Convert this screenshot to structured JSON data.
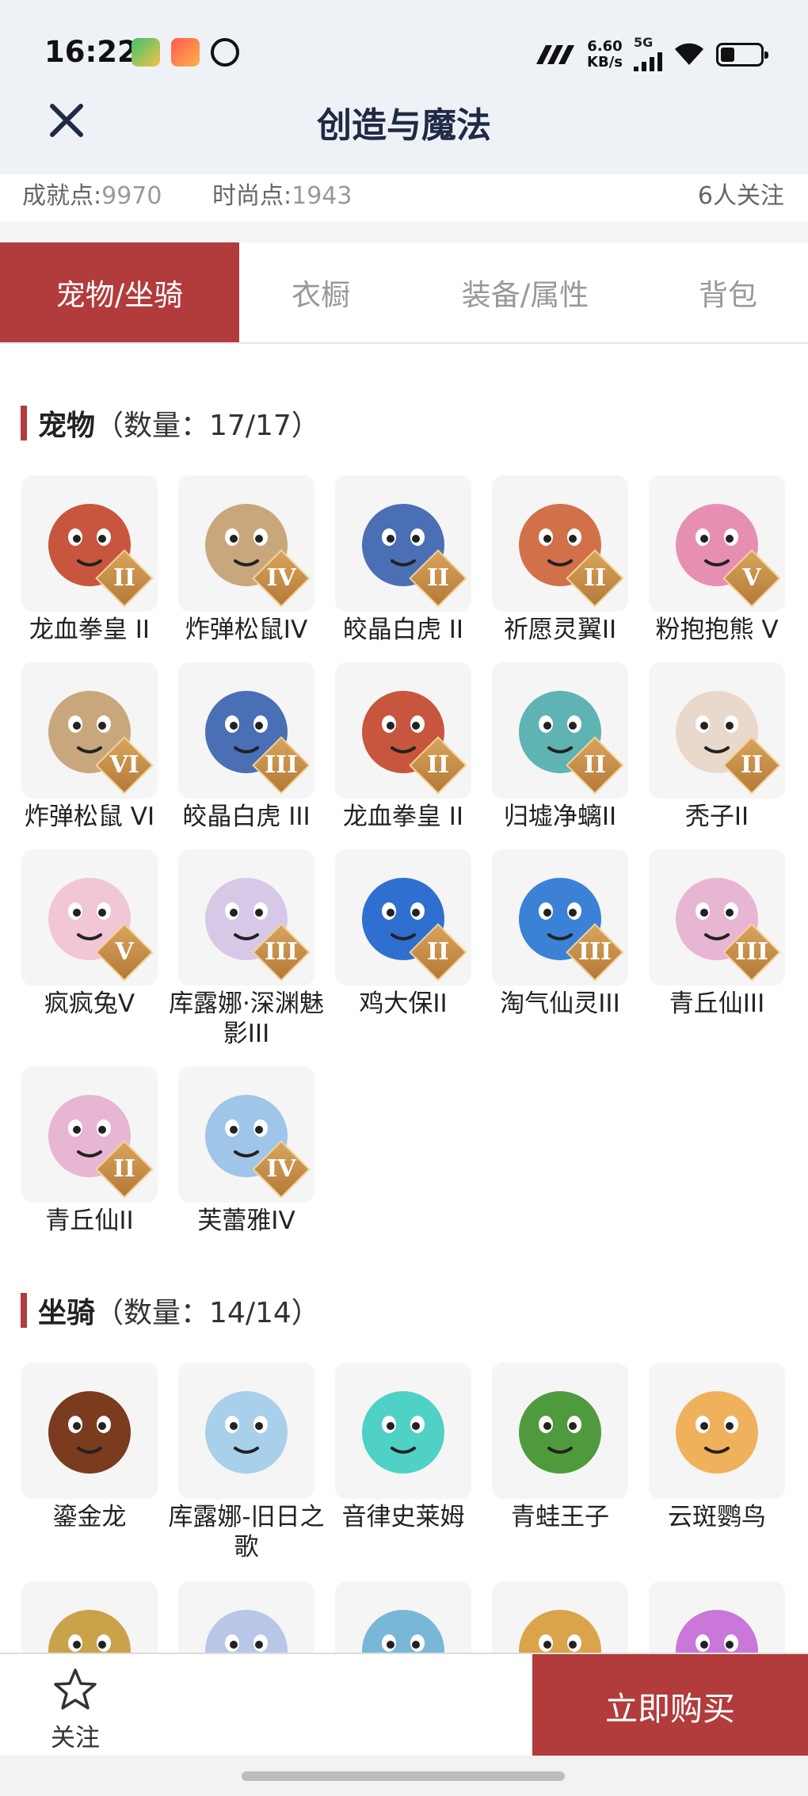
{
  "status_bar": {
    "time": "16:22",
    "net_speed_value": "6.60",
    "net_speed_unit": "KB/s",
    "network_type": "5G",
    "battery_level": 0.35
  },
  "header": {
    "title": "创造与魔法"
  },
  "stats": {
    "achievement_label": "成就点:",
    "achievement_value": "9970",
    "fashion_label": "时尚点:",
    "fashion_value": "1943",
    "followers": "6人关注"
  },
  "tabs": [
    {
      "label": "宠物/坐骑",
      "active": true
    },
    {
      "label": "衣橱",
      "active": false
    },
    {
      "label": "装备/属性",
      "active": false
    },
    {
      "label": "背包",
      "active": false
    }
  ],
  "pets_section": {
    "name": "宠物",
    "count": "（数量：17/17）"
  },
  "pets": [
    {
      "name": "龙血拳皇 II",
      "rank": "II",
      "icon": "dragon-boxer-icon",
      "color": "#c8553d"
    },
    {
      "name": "炸弹松鼠IV",
      "rank": "IV",
      "icon": "bomb-squirrel-icon",
      "color": "#c9a77c"
    },
    {
      "name": "皎晶白虎 II",
      "rank": "II",
      "icon": "white-tiger-icon",
      "color": "#4a6fb5"
    },
    {
      "name": "祈愿灵翼II",
      "rank": "II",
      "icon": "spirit-wing-icon",
      "color": "#d2704a"
    },
    {
      "name": "粉抱抱熊 V",
      "rank": "V",
      "icon": "pink-bear-icon",
      "color": "#e78fb3"
    },
    {
      "name": "炸弹松鼠 VI",
      "rank": "VI",
      "icon": "bomb-squirrel-icon",
      "color": "#c9a77c"
    },
    {
      "name": "皎晶白虎 III",
      "rank": "III",
      "icon": "white-tiger-icon",
      "color": "#4a6fb5"
    },
    {
      "name": "龙血拳皇 II",
      "rank": "II",
      "icon": "dragon-boxer-icon",
      "color": "#c8553d"
    },
    {
      "name": "归墟净螭II",
      "rank": "II",
      "icon": "water-dragon-icon",
      "color": "#5fb3b3"
    },
    {
      "name": "秃子II",
      "rank": "II",
      "icon": "bald-kid-icon",
      "color": "#e9d8cc"
    },
    {
      "name": "疯疯兔V",
      "rank": "V",
      "icon": "crazy-rabbit-icon",
      "color": "#f1c6d6"
    },
    {
      "name": "库露娜·深渊魅影III",
      "rank": "III",
      "icon": "kuluna-icon",
      "color": "#d7c8e8"
    },
    {
      "name": "鸡大保II",
      "rank": "II",
      "icon": "blue-chicken-icon",
      "color": "#2f6fd0"
    },
    {
      "name": "淘气仙灵III",
      "rank": "III",
      "icon": "blue-dog-icon",
      "color": "#3b82d6"
    },
    {
      "name": "青丘仙III",
      "rank": "III",
      "icon": "fox-fairy-icon",
      "color": "#e7b6d3"
    },
    {
      "name": "青丘仙II",
      "rank": "II",
      "icon": "fox-fairy-icon",
      "color": "#e7b6d3"
    },
    {
      "name": "芙蕾雅IV",
      "rank": "IV",
      "icon": "freya-icon",
      "color": "#9fc5e8"
    }
  ],
  "mounts_section": {
    "name": "坐骑",
    "count": "（数量：14/14）"
  },
  "mounts": [
    {
      "name": "鎏金龙",
      "icon": "gold-dragon-icon",
      "color": "#7a3b1e"
    },
    {
      "name": "库露娜-旧日之歌",
      "icon": "kuluna-song-icon",
      "color": "#a9d0ea"
    },
    {
      "name": "音律史莱姆",
      "icon": "slime-icon",
      "color": "#4fd1c5"
    },
    {
      "name": "青蛙王子",
      "icon": "frog-prince-icon",
      "color": "#4f9a3c"
    },
    {
      "name": "云斑鹦鸟",
      "icon": "parrot-icon",
      "color": "#f0b15c"
    },
    {
      "name": "",
      "icon": "mount-partial-icon",
      "color": "#caa24a"
    },
    {
      "name": "",
      "icon": "mount-partial-icon",
      "color": "#b8c6e8"
    },
    {
      "name": "",
      "icon": "mount-partial-icon",
      "color": "#79b7d8"
    },
    {
      "name": "",
      "icon": "mount-partial-icon",
      "color": "#d9a44a"
    },
    {
      "name": "",
      "icon": "mount-partial-icon",
      "color": "#c978d9"
    }
  ],
  "bottom_bar": {
    "follow_label": "关注",
    "buy_label": "立即购买"
  },
  "colors": {
    "accent": "#b23b3b",
    "header_bg": "#eef2f7"
  }
}
